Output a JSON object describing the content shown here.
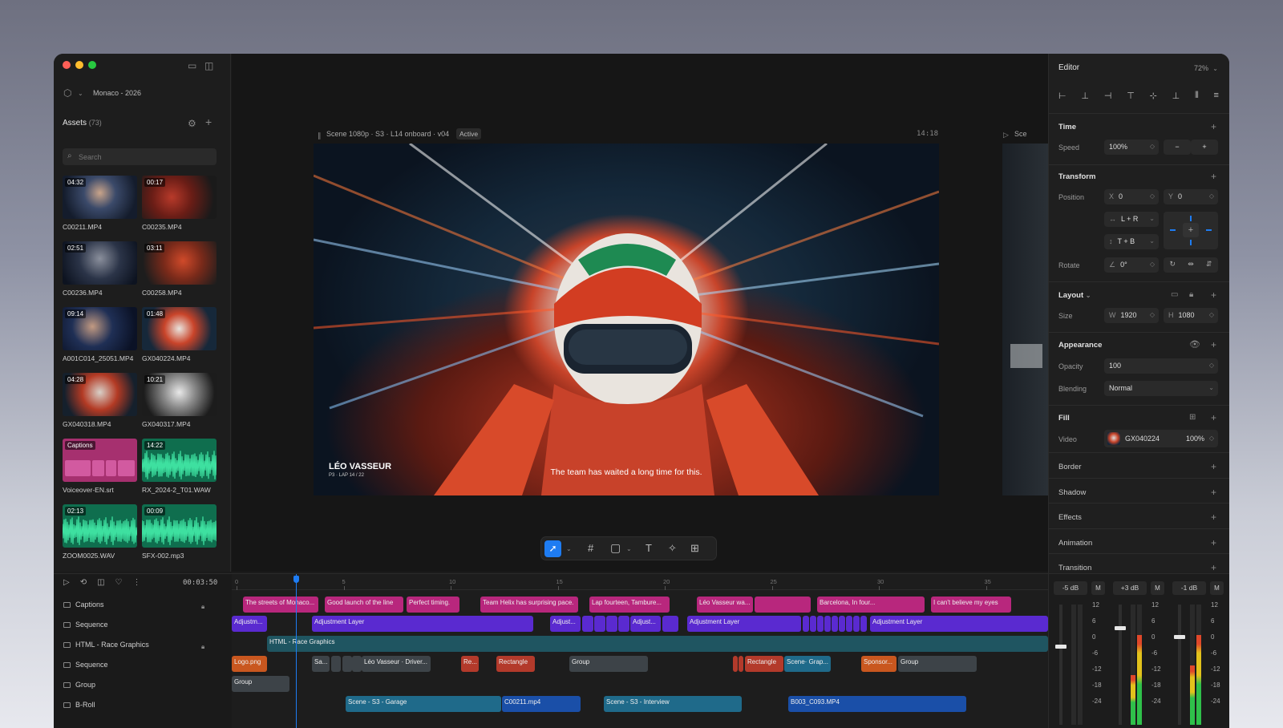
{
  "project": {
    "name": "Monaco - 2026"
  },
  "assets": {
    "title": "Assets",
    "count": "(73)",
    "search_placeholder": "Search",
    "items": [
      {
        "name": "C00211.MP4",
        "duration": "04:32"
      },
      {
        "name": "C00235.MP4",
        "duration": "00:17"
      },
      {
        "name": "C00236.MP4",
        "duration": "02:51"
      },
      {
        "name": "C00258.MP4",
        "duration": "03:11"
      },
      {
        "name": "A001C014_25051.MP4",
        "duration": "09:14"
      },
      {
        "name": "GX040224.MP4",
        "duration": "01:48"
      },
      {
        "name": "GX040318.MP4",
        "duration": "04:28"
      },
      {
        "name": "GX040317.MP4",
        "duration": "10:21"
      },
      {
        "name": "Voiceover-EN.srt",
        "duration": "Captions"
      },
      {
        "name": "RX_2024-2_T01.WAW",
        "duration": "14:22"
      },
      {
        "name": "ZOOM0025.WAV",
        "duration": "02:13"
      },
      {
        "name": "SFX-002.mp3",
        "duration": "00:09"
      }
    ]
  },
  "viewer": {
    "scene_title": "Scene 1080p · S3 · L14 onboard · v04",
    "badge": "Active",
    "timecode": "14:18",
    "next_scene": "Sce",
    "lower_third_name": "LÉO VASSEUR",
    "lower_third_sub": "P3 · LAP 14 / 22",
    "caption": "The team has waited a long time for this."
  },
  "editor": {
    "title": "Editor",
    "zoom": "72%",
    "time": {
      "label": "Time",
      "speed_label": "Speed",
      "speed": "100%",
      "minus": "−",
      "plus": "+"
    },
    "transform": {
      "label": "Transform",
      "position_label": "Position",
      "x_label": "X",
      "x": "0",
      "y_label": "Y",
      "y": "0",
      "h_constraint": "L + R",
      "v_constraint": "T + B",
      "rotate_label": "Rotate",
      "rotate": "0°"
    },
    "layout": {
      "label": "Layout",
      "size_label": "Size",
      "w_label": "W",
      "w": "1920",
      "h_label": "H",
      "h": "1080"
    },
    "appearance": {
      "label": "Appearance",
      "opacity_label": "Opacity",
      "opacity": "100",
      "blending_label": "Blending",
      "blending": "Normal"
    },
    "fill": {
      "label": "Fill",
      "video_label": "Video",
      "video_name": "GX040224",
      "video_pct": "100%"
    },
    "sections": [
      "Border",
      "Shadow",
      "Effects",
      "Animation",
      "Transition"
    ]
  },
  "timeline": {
    "timecode": "00:03:50",
    "ruler": [
      "0",
      "5",
      "10",
      "15",
      "20",
      "25",
      "30",
      "35"
    ],
    "tracks": [
      "Captions",
      "Sequence",
      "HTML - Race Graphics",
      "Sequence",
      "Group",
      "B-Roll"
    ],
    "captions": [
      "The streets of Monaco...",
      "Good launch of the line",
      "Perfect timing.",
      "Team Helix has surprising pace.",
      "Lap fourteen, Tambure...",
      "Léo Vasseur wa...",
      "Barcelona, In four...",
      "I can't believe my eyes"
    ],
    "adjust": [
      "Adjustm...",
      "Adjustment Layer",
      "Adjust...",
      "Adjust...",
      "Adjustment Layer",
      "Adjustment Layer"
    ],
    "html_clip": "HTML - Race Graphics",
    "gfx": [
      "Logo.png",
      "Sa...",
      "Léo Vasseur · Driver...",
      "Re...",
      "Rectangle",
      "Group",
      "Rectangle",
      "Scene· Grap...",
      "Sponsor...",
      "Group"
    ],
    "group2": "Group",
    "broll": [
      "Scene - S3 - Garage",
      "C00211.mp4",
      "Scene - S3 - Interview",
      "B003_C093.MP4"
    ]
  },
  "mixer": {
    "channels": [
      {
        "db": "-5 dB",
        "m": "M"
      },
      {
        "db": "+3 dB",
        "m": "M"
      },
      {
        "db": "-1 dB",
        "m": "M"
      }
    ],
    "scale": [
      "12",
      "6",
      "0",
      "-6",
      "-12",
      "-18",
      "-24"
    ]
  },
  "colors": {
    "accent": "#1e7cf2",
    "caption_clip": "#b8277d",
    "adjust_clip": "#5a2ad0",
    "html_clip": "#1f5561",
    "gfx_clip": "#3d4348",
    "orange_clip": "#c9571f",
    "red_clip": "#b33a2b",
    "teal_clip": "#1f6a8a",
    "broll_clip": "#1a4fa8"
  }
}
